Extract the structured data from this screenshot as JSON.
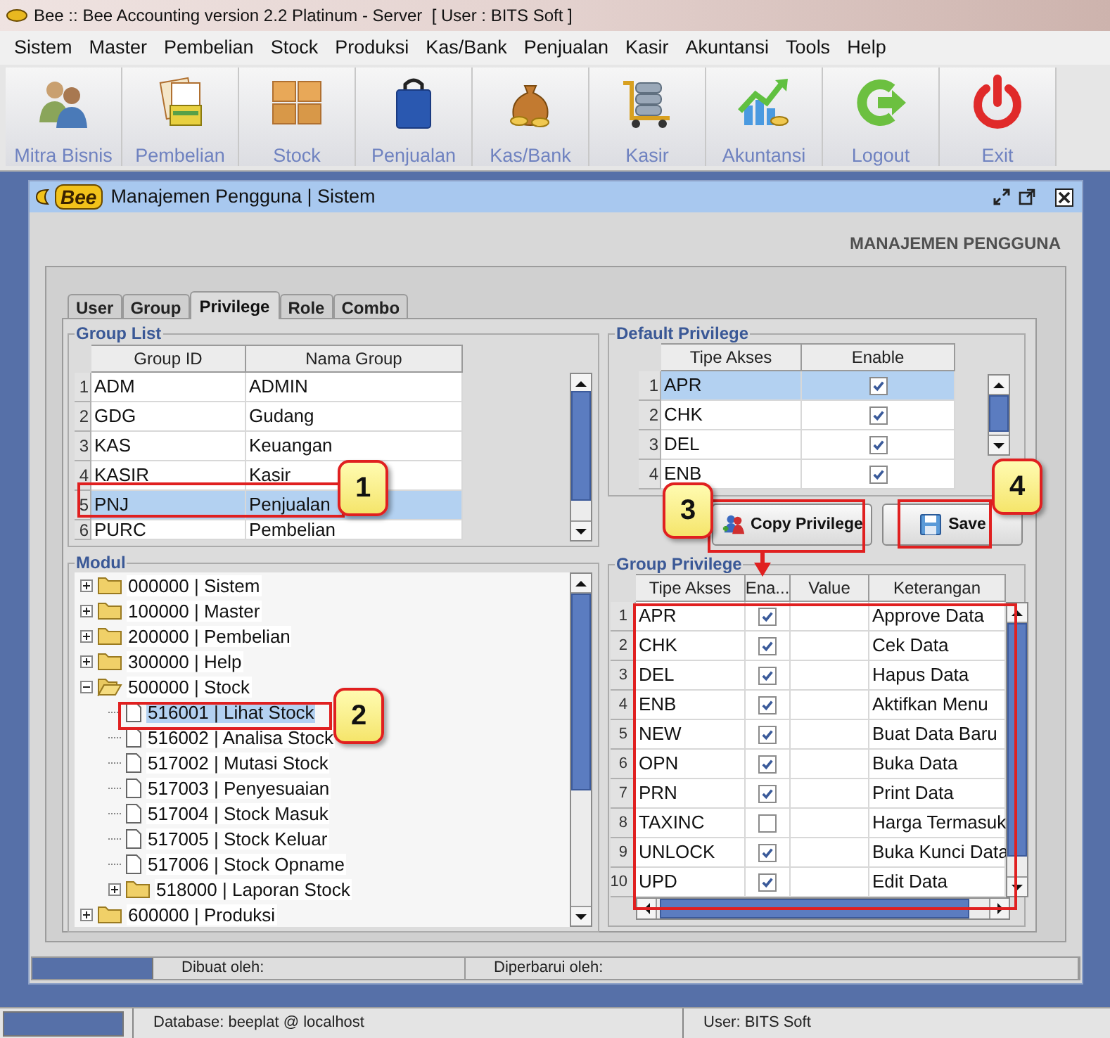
{
  "window": {
    "title": "Bee :: Bee Accounting version 2.2 Platinum - Server  [ User : BITS Soft ]"
  },
  "menu": [
    "Sistem",
    "Master",
    "Pembelian",
    "Stock",
    "Produksi",
    "Kas/Bank",
    "Penjualan",
    "Kasir",
    "Akuntansi",
    "Tools",
    "Help"
  ],
  "toolbar": [
    {
      "label": "Mitra Bisnis"
    },
    {
      "label": "Pembelian"
    },
    {
      "label": "Stock"
    },
    {
      "label": "Penjualan"
    },
    {
      "label": "Kas/Bank"
    },
    {
      "label": "Kasir"
    },
    {
      "label": "Akuntansi"
    },
    {
      "label": "Logout"
    },
    {
      "label": "Exit"
    }
  ],
  "child_window": {
    "logo": "Bee",
    "title": "Manajemen Pengguna | Sistem",
    "heading": "MANAJEMEN PENGGUNA",
    "tabs": [
      {
        "label": "User",
        "selected": false
      },
      {
        "label": "Group",
        "selected": false
      },
      {
        "label": "Privilege",
        "selected": true
      },
      {
        "label": "Role",
        "selected": false
      },
      {
        "label": "Combo",
        "selected": false
      }
    ],
    "group_list": {
      "title": "Group List",
      "columns": [
        "Group ID",
        "Nama Group"
      ],
      "rows": [
        {
          "no": "1",
          "id": "ADM",
          "name": "ADMIN",
          "selected": false
        },
        {
          "no": "2",
          "id": "GDG",
          "name": "Gudang",
          "selected": false
        },
        {
          "no": "3",
          "id": "KAS",
          "name": "Keuangan",
          "selected": false
        },
        {
          "no": "4",
          "id": "KASIR",
          "name": "Kasir",
          "selected": false
        },
        {
          "no": "5",
          "id": "PNJ",
          "name": "Penjualan",
          "selected": true
        },
        {
          "no": "6",
          "id": "PURC",
          "name": "Pembelian",
          "selected": false
        }
      ]
    },
    "default_privilege": {
      "title": "Default Privilege",
      "columns": [
        "Tipe Akses",
        "Enable"
      ],
      "rows": [
        {
          "no": "1",
          "type": "APR",
          "enabled": true,
          "selected": true
        },
        {
          "no": "2",
          "type": "CHK",
          "enabled": true,
          "selected": false
        },
        {
          "no": "3",
          "type": "DEL",
          "enabled": true,
          "selected": false
        },
        {
          "no": "4",
          "type": "ENB",
          "enabled": true,
          "selected": false
        }
      ]
    },
    "buttons": [
      {
        "label": "Copy Privilege"
      },
      {
        "label": "Save"
      }
    ],
    "modul": {
      "title": "Modul",
      "tree": [
        {
          "label": "000000 | Sistem",
          "kind": "folder",
          "expanded": false,
          "selected": false
        },
        {
          "label": "100000 | Master",
          "kind": "folder",
          "expanded": false,
          "selected": false
        },
        {
          "label": "200000 | Pembelian",
          "kind": "folder",
          "expanded": false,
          "selected": false
        },
        {
          "label": "300000 | Help",
          "kind": "folder",
          "expanded": false,
          "selected": false
        },
        {
          "label": "500000 | Stock",
          "kind": "folder",
          "expanded": true,
          "selected": false,
          "children": [
            {
              "label": "516001 | Lihat Stock",
              "kind": "file",
              "selected": true
            },
            {
              "label": "516002 | Analisa Stock",
              "kind": "file",
              "selected": false
            },
            {
              "label": "517002 | Mutasi Stock",
              "kind": "file",
              "selected": false
            },
            {
              "label": "517003 | Penyesuaian",
              "kind": "file",
              "selected": false
            },
            {
              "label": "517004 | Stock Masuk",
              "kind": "file",
              "selected": false
            },
            {
              "label": "517005 | Stock Keluar",
              "kind": "file",
              "selected": false
            },
            {
              "label": "517006 | Stock Opname",
              "kind": "file",
              "selected": false
            },
            {
              "label": "518000 | Laporan Stock",
              "kind": "folder",
              "expanded": false,
              "selected": false
            }
          ]
        },
        {
          "label": "600000 | Produksi",
          "kind": "folder",
          "expanded": false,
          "selected": false
        }
      ]
    },
    "group_privilege": {
      "title": "Group Privilege",
      "columns": [
        "Tipe Akses",
        "Ena...",
        "Value",
        "Keterangan"
      ],
      "rows": [
        {
          "no": "1",
          "type": "APR",
          "enabled": true,
          "description": "Approve Data"
        },
        {
          "no": "2",
          "type": "CHK",
          "enabled": true,
          "description": "Cek Data"
        },
        {
          "no": "3",
          "type": "DEL",
          "enabled": true,
          "description": "Hapus Data"
        },
        {
          "no": "4",
          "type": "ENB",
          "enabled": true,
          "description": "Aktifkan Menu"
        },
        {
          "no": "5",
          "type": "NEW",
          "enabled": true,
          "description": "Buat Data Baru"
        },
        {
          "no": "6",
          "type": "OPN",
          "enabled": true,
          "description": "Buka Data"
        },
        {
          "no": "7",
          "type": "PRN",
          "enabled": true,
          "description": "Print Data"
        },
        {
          "no": "8",
          "type": "TAXINC",
          "enabled": false,
          "description": "Harga Termasuk"
        },
        {
          "no": "9",
          "type": "UNLOCK",
          "enabled": true,
          "description": "Buka Kunci Data"
        },
        {
          "no": "10",
          "type": "UPD",
          "enabled": true,
          "description": "Edit Data"
        }
      ]
    },
    "status_bar": [
      "Dibuat oleh:",
      "Diperbarui oleh:"
    ]
  },
  "status_bar": [
    "Database: beeplat @ localhost",
    "User: BITS Soft"
  ],
  "annotations": [
    {
      "label": "1"
    },
    {
      "label": "2"
    },
    {
      "label": "3"
    },
    {
      "label": "4"
    }
  ]
}
